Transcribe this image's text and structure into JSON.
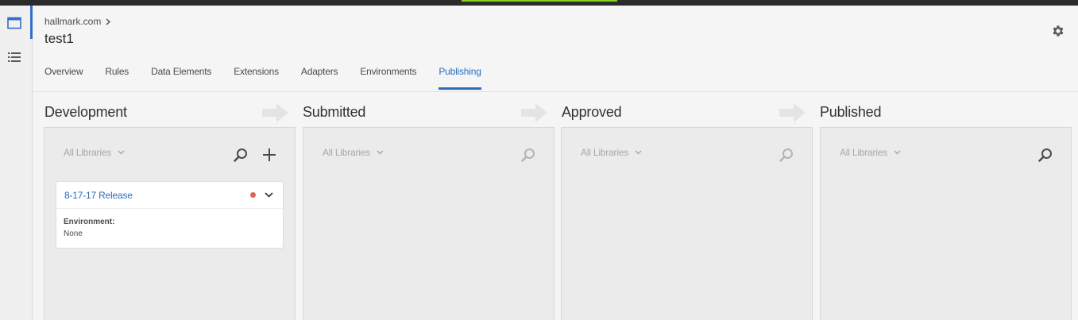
{
  "breadcrumb": {
    "company": "hallmark.com"
  },
  "property": {
    "title": "test1"
  },
  "tabs": [
    "Overview",
    "Rules",
    "Data Elements",
    "Extensions",
    "Adapters",
    "Environments",
    "Publishing"
  ],
  "active_tab": "Publishing",
  "columns": [
    {
      "title": "Development",
      "filter": "All Libraries"
    },
    {
      "title": "Submitted",
      "filter": "All Libraries"
    },
    {
      "title": "Approved",
      "filter": "All Libraries"
    },
    {
      "title": "Published",
      "filter": "All Libraries"
    }
  ],
  "library_card": {
    "name": "8-17-17 Release",
    "environment_label": "Environment:",
    "environment_value": "None",
    "status_color": "#e0625a"
  },
  "colors": {
    "accent": "#2d6cc0",
    "top_bar": "#2b2b2b",
    "top_indicator": "#7ed321"
  }
}
